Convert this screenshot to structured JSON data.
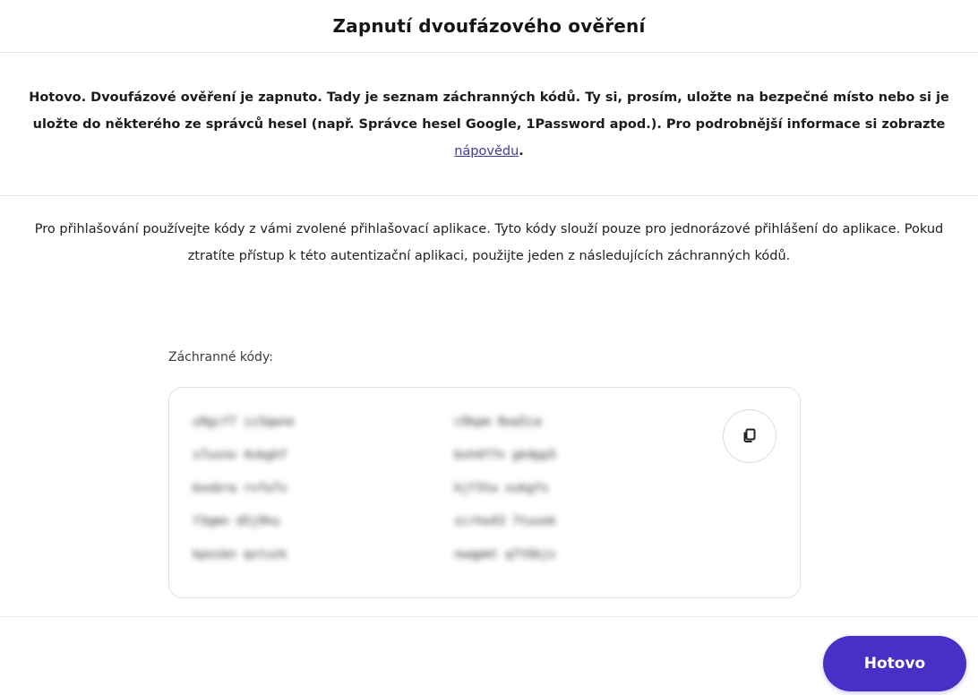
{
  "dialog": {
    "title": "Zapnutí dvoufázového ověření"
  },
  "intro": {
    "text_before_link": "Hotovo. Dvoufázové ověření je zapnuto. Tady je seznam záchranných kódů. Ty si, prosím, uložte na bezpečné místo nebo si je uložte do některého ze správců hesel (např. Správce hesel Google, 1Password apod.). Pro podrobnější informace si zobrazte ",
    "link_label": "nápovědu",
    "text_after_link": "."
  },
  "info": {
    "text": "Pro přihlašování používejte kódy z vámi zvolené přihlašovací aplikace. Tyto kódy slouží pouze pro jednorázové přihlášení do aplikace. Pokud ztratíte přístup k této autentizační aplikaci, použijte jeden z následujících záchranných kódů."
  },
  "codes": {
    "label": "Záchranné kódy:",
    "column_a": [
      "u9gcf7 iz3qwne",
      "s7uvno 4vbghf",
      "bxebra rvfw7s",
      "f3qmn d5j9hu",
      "kposbn qvtuzk"
    ],
    "column_b": [
      "c9kpm 8oa5ia",
      "bxh4f7n gk4pp5",
      "kjf3tw xukgfs",
      "zcrhe43 7tuvek",
      "nwqpmt q7t6bjs"
    ],
    "blurred": true,
    "copy_icon": "copy-icon"
  },
  "footer": {
    "done_label": "Hotovo"
  },
  "colors": {
    "primary": "#4a2fc7",
    "link": "#3d3a9c",
    "divider": "#e6e6ea"
  }
}
